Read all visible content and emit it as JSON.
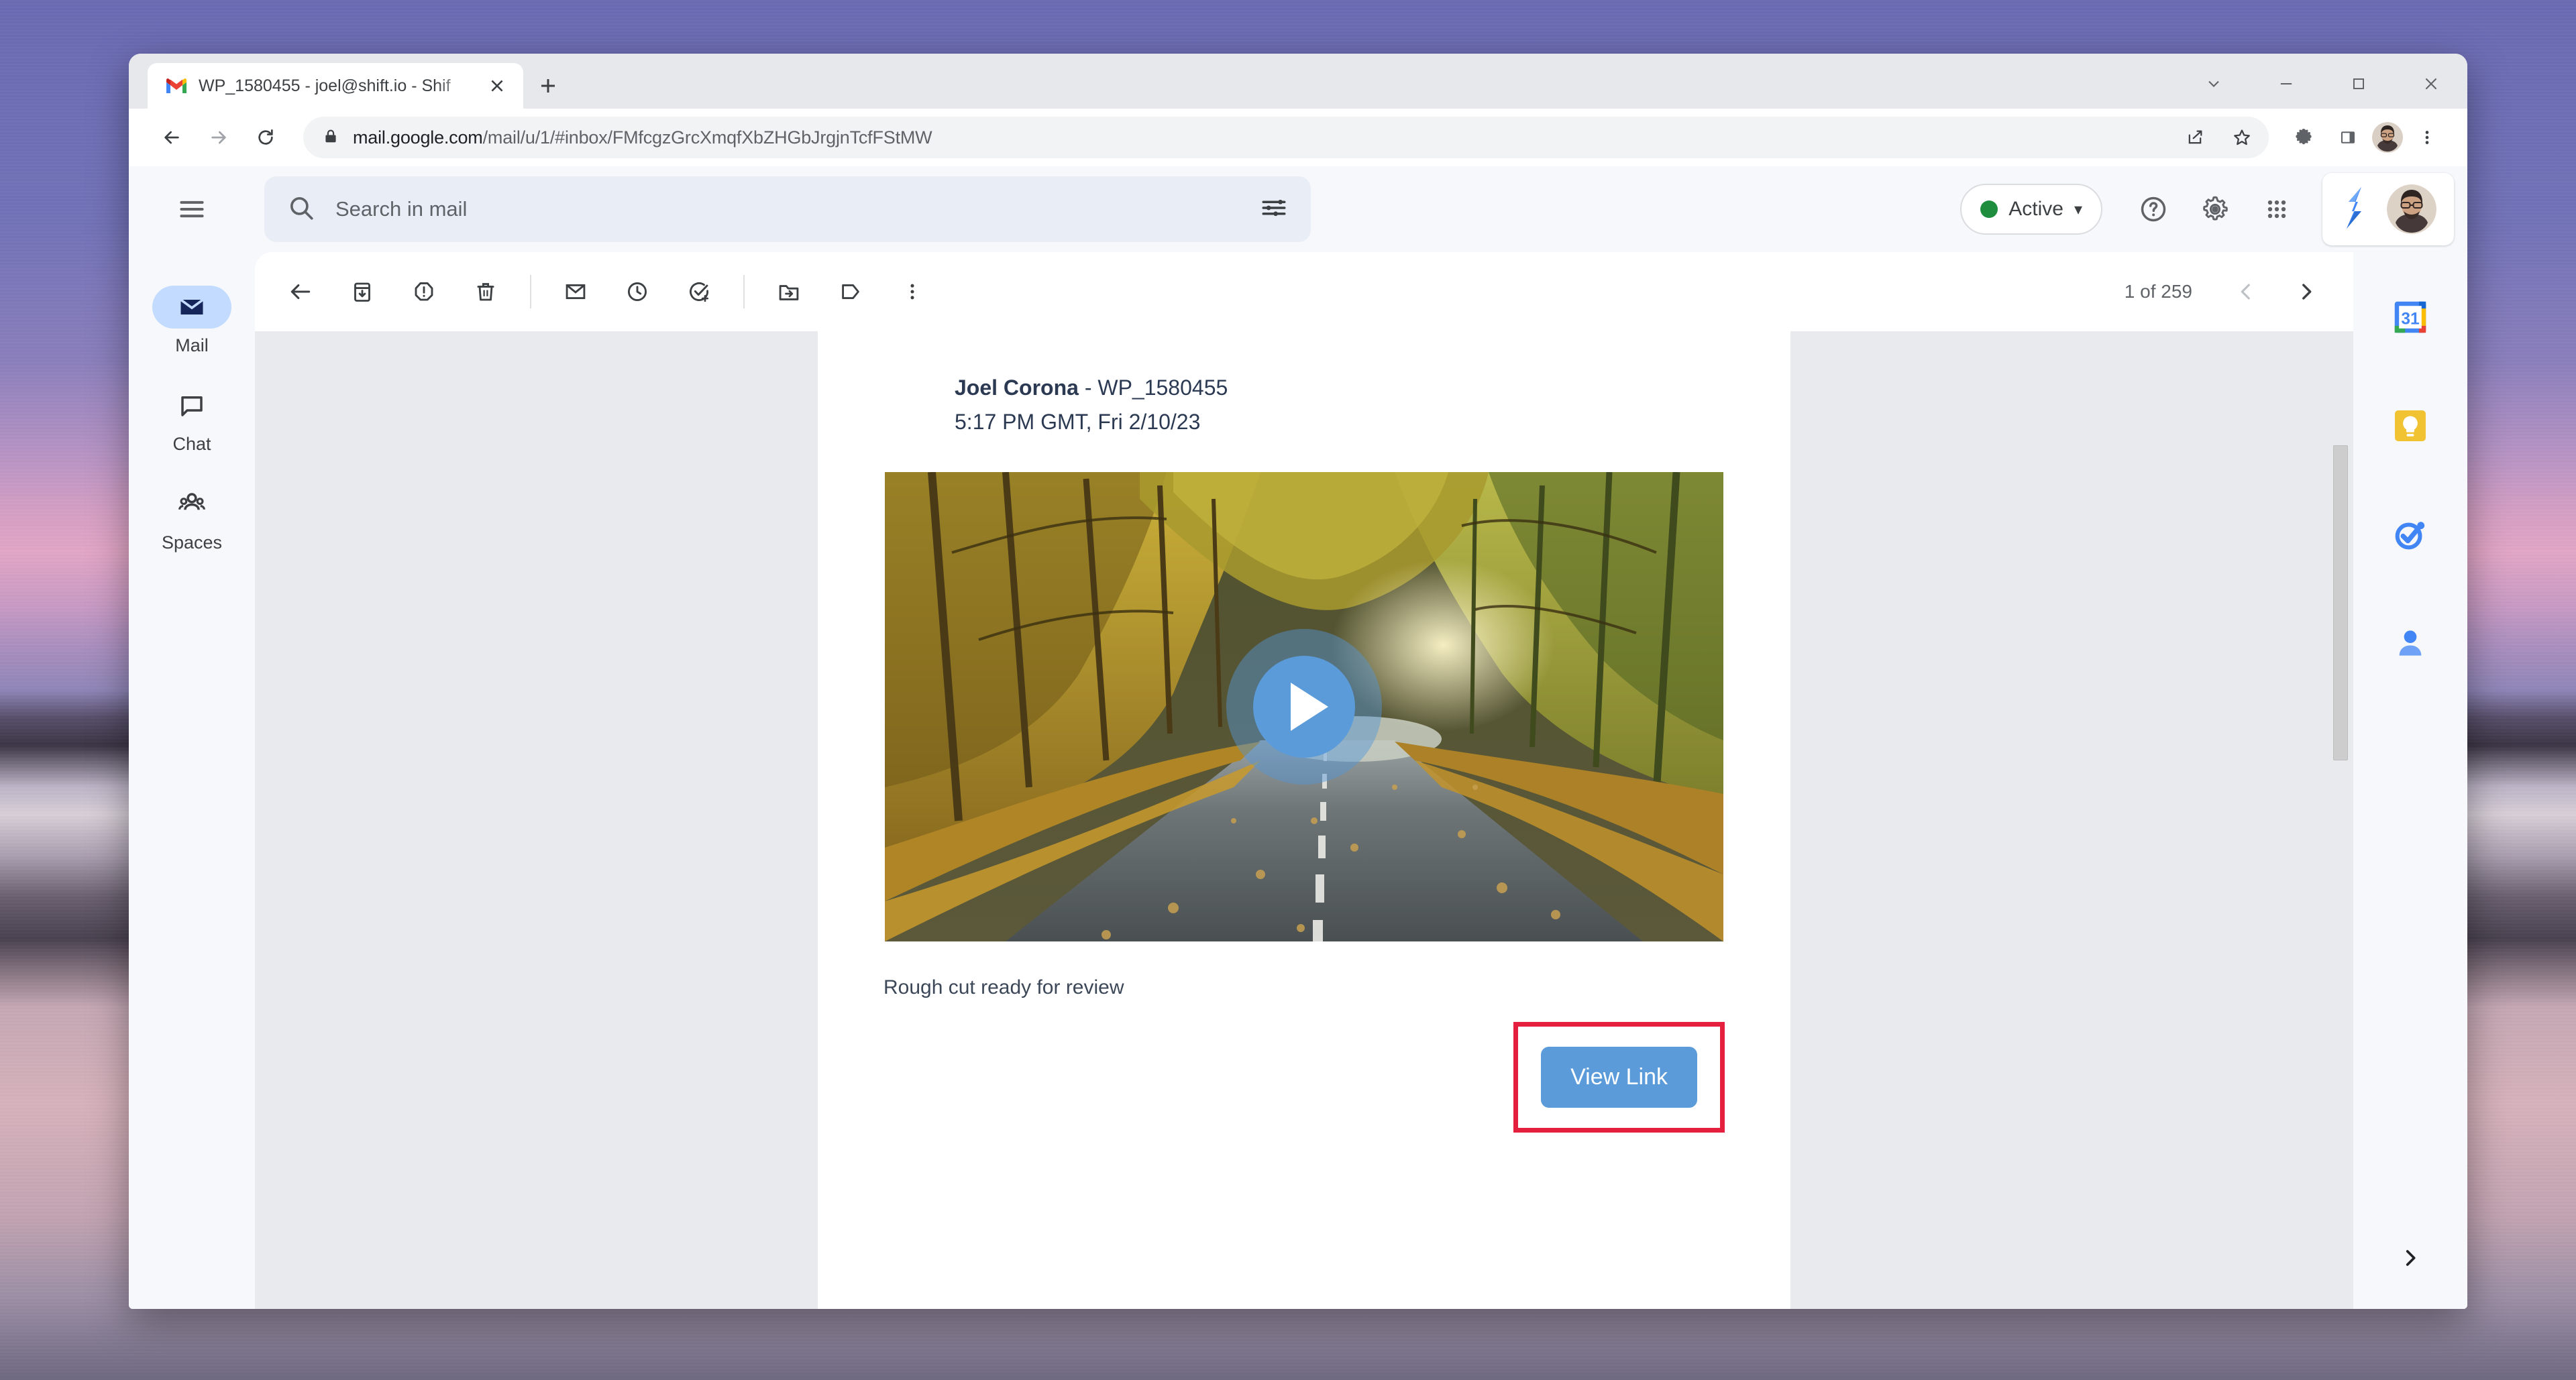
{
  "window": {
    "tab": {
      "title": "WP_1580455 - joel@shift.io - Shif",
      "favicon": "gmail-icon",
      "close": "×",
      "new_tab": "+"
    },
    "controls": {
      "tab_search": "tab-search-icon",
      "minimize": "minimize-icon",
      "maximize": "maximize-icon",
      "close": "close-icon"
    },
    "omnibox": {
      "back": "back-arrow-icon",
      "forward": "forward-arrow-icon",
      "reload": "reload-icon",
      "lock": "lock-icon",
      "url_domain": "mail.google.com",
      "url_path": "/mail/u/1/#inbox/FMfcgzGrcXmqfXbZHGbJrgjnTcfFStMW",
      "share": "share-icon",
      "bookmark": "star-icon",
      "extensions": "puzzle-icon",
      "side_panel": "side-panel-icon",
      "profile": "profile-avatar",
      "menu": "three-dot-menu-icon"
    }
  },
  "gmail": {
    "menu_icon": "hamburger-menu-icon",
    "search": {
      "icon": "search-icon",
      "placeholder": "Search in mail",
      "value": "",
      "filter_icon": "tune-filter-icon"
    },
    "status": {
      "label": "Active",
      "dot_color": "#1e8e3e",
      "caret": "▾"
    },
    "header_icons": {
      "help": "help-icon",
      "settings": "gear-icon",
      "apps": "apps-grid-icon"
    },
    "account": {
      "app_logo": "shift-logo",
      "avatar": "user-avatar"
    },
    "rail": [
      {
        "label": "Mail",
        "icon": "mail-icon",
        "active": true
      },
      {
        "label": "Chat",
        "icon": "chat-icon",
        "active": false
      },
      {
        "label": "Spaces",
        "icon": "spaces-icon",
        "active": false
      }
    ],
    "toolbar": [
      {
        "name": "back",
        "icon": "back-arrow-icon"
      },
      {
        "name": "archive",
        "icon": "archive-icon"
      },
      {
        "name": "report-spam",
        "icon": "report-spam-icon"
      },
      {
        "name": "delete",
        "icon": "trash-icon"
      },
      {
        "name": "mark-unread",
        "icon": "envelope-icon"
      },
      {
        "name": "snooze",
        "icon": "clock-icon"
      },
      {
        "name": "add-to-tasks",
        "icon": "task-add-icon"
      },
      {
        "name": "move-to",
        "icon": "folder-move-icon"
      },
      {
        "name": "labels",
        "icon": "label-tag-icon"
      },
      {
        "name": "more",
        "icon": "more-vert-icon"
      }
    ],
    "pager": {
      "text": "1 of 259",
      "prev": "chevron-left-icon",
      "next": "chevron-right-icon"
    },
    "right_rail": [
      {
        "name": "calendar",
        "icon": "google-calendar-icon",
        "badge": "31"
      },
      {
        "name": "keep",
        "icon": "google-keep-icon"
      },
      {
        "name": "tasks",
        "icon": "google-tasks-icon"
      },
      {
        "name": "contacts",
        "icon": "google-contacts-icon"
      },
      {
        "name": "expand-panel",
        "icon": "chevron-right-icon"
      }
    ]
  },
  "message": {
    "sender": "Joel Corona",
    "separator": " - ",
    "subject": "WP_1580455",
    "timestamp": "5:17 PM GMT, Fri 2/10/23",
    "video": {
      "alt": "autumn forest road video thumbnail",
      "play_icon": "play-button-icon"
    },
    "note": "Rough cut ready for review",
    "cta_label": "View Link",
    "cta_color": "#5b9bd9",
    "highlight_color": "#e51f3e"
  }
}
